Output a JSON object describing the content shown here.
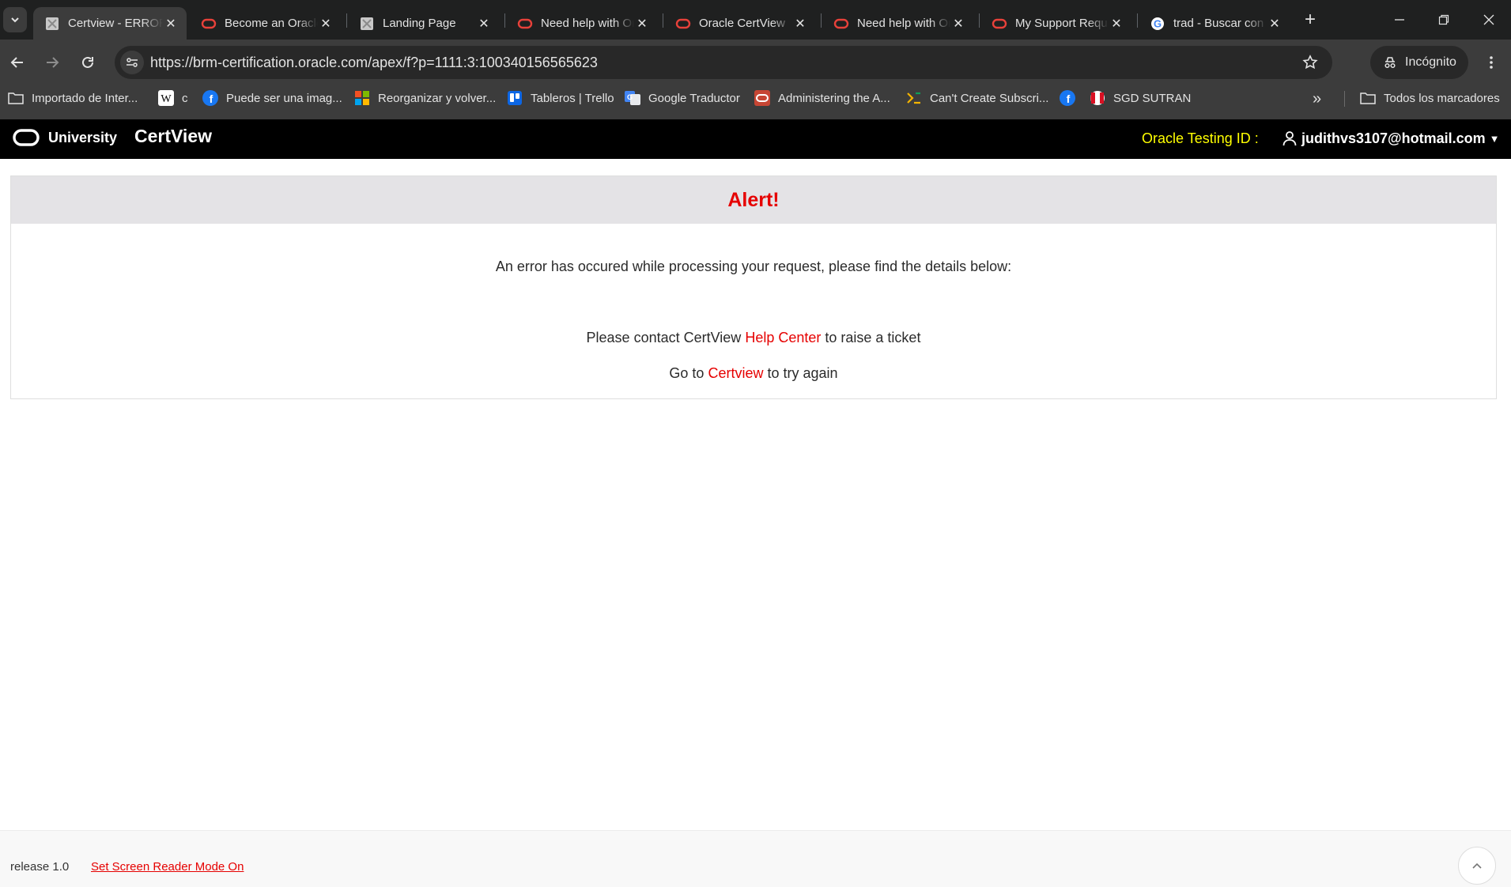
{
  "browser": {
    "tabs": [
      {
        "title": "Certview - ERROR",
        "favicon": "generic-page-icon",
        "active": true
      },
      {
        "title": "Become an Oracle",
        "favicon": "oracle-icon"
      },
      {
        "title": "Landing Page",
        "favicon": "generic-page-icon"
      },
      {
        "title": "Need help with Oracle",
        "favicon": "oracle-icon"
      },
      {
        "title": "Oracle CertView",
        "favicon": "oracle-icon"
      },
      {
        "title": "Need help with Oracle",
        "favicon": "oracle-icon"
      },
      {
        "title": "My Support Requests",
        "favicon": "oracle-icon"
      },
      {
        "title": "trad - Buscar con Google",
        "favicon": "google-icon"
      }
    ],
    "url": "https://brm-certification.oracle.com/apex/f?p=1111:3:100340156565623",
    "incognito_label": "Incógnito",
    "bookmarks": [
      {
        "label": "Importado de Inter...",
        "icon": "folder-icon"
      },
      {
        "label": "c",
        "icon": "wikipedia-icon"
      },
      {
        "label": "Puede ser una imag...",
        "icon": "facebook-icon"
      },
      {
        "label": "Reorganizar y volver...",
        "icon": "microsoft-icon"
      },
      {
        "label": "Tableros | Trello",
        "icon": "trello-icon"
      },
      {
        "label": "Google Traductor",
        "icon": "translate-icon"
      },
      {
        "label": "Administering the A...",
        "icon": "oracle-icon"
      },
      {
        "label": "Can't Create Subscri...",
        "icon": "globe-icon"
      },
      {
        "label": "",
        "icon": "facebook-icon"
      },
      {
        "label": "SGD SUTRAN",
        "icon": "peru-flag-icon"
      }
    ],
    "all_bookmarks_label": "Todos los marcadores"
  },
  "app": {
    "brand": "University",
    "name": "CertView",
    "testing_id_label": "Oracle Testing ID :",
    "user_email": "judithvs3107@hotmail.com"
  },
  "alert": {
    "title": "Alert!",
    "message": "An error has occured while processing your request, please find the details below:",
    "contact_prefix": "Please contact CertView",
    "contact_link": "Help Center",
    "contact_suffix": "to raise a ticket",
    "goto_prefix": "Go to",
    "goto_link": "Certview",
    "goto_suffix": "to try again"
  },
  "footer": {
    "release": "release 1.0",
    "screen_reader": "Set Screen Reader Mode On"
  },
  "colors": {
    "accent_red": "#e60000",
    "testing_id_yellow": "#ffff00",
    "appbar_black": "#000000"
  }
}
